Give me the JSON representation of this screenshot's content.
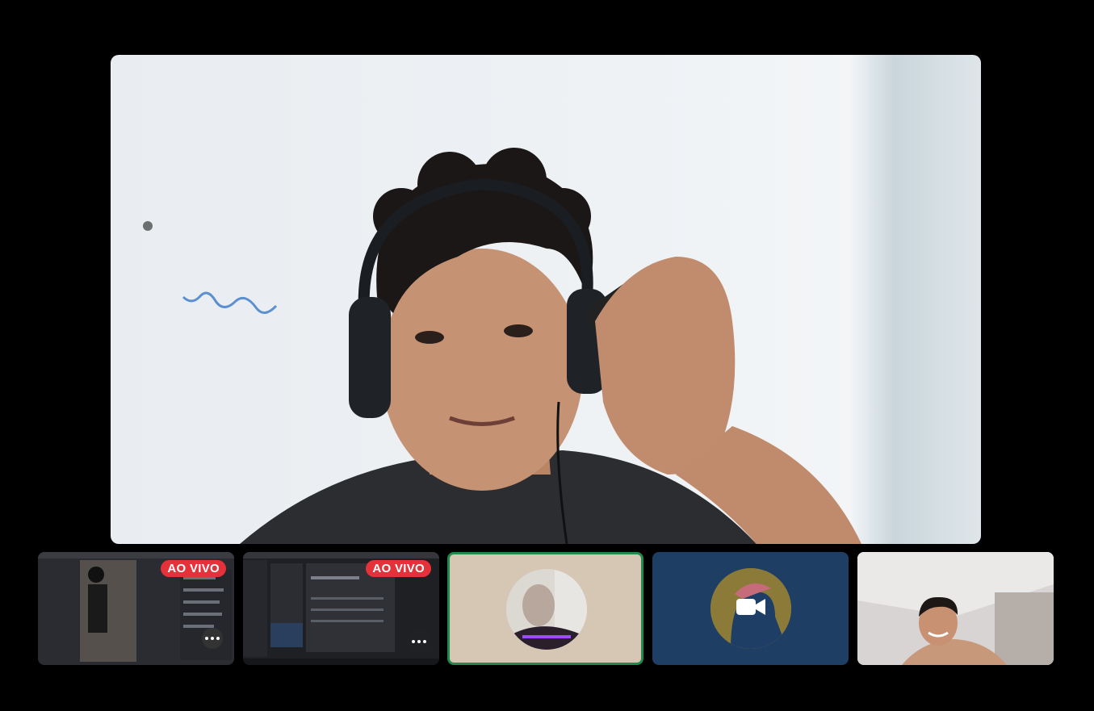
{
  "window": {
    "title": ""
  },
  "participants": [
    {
      "tile": "screen-share-1",
      "badge": "AO VIVO"
    },
    {
      "tile": "screen-share-2",
      "badge": "AO VIVO"
    },
    {
      "tile": "participant-avatar-photo"
    },
    {
      "tile": "participant-camera-off"
    },
    {
      "tile": "participant-video"
    }
  ],
  "colors": {
    "live": "#e5323a",
    "active_speaker_border": "#1f8a4c",
    "camera_off_bg": "#1f3e63"
  },
  "icons": {
    "more": "more-options-icon",
    "camera": "camera-icon"
  }
}
